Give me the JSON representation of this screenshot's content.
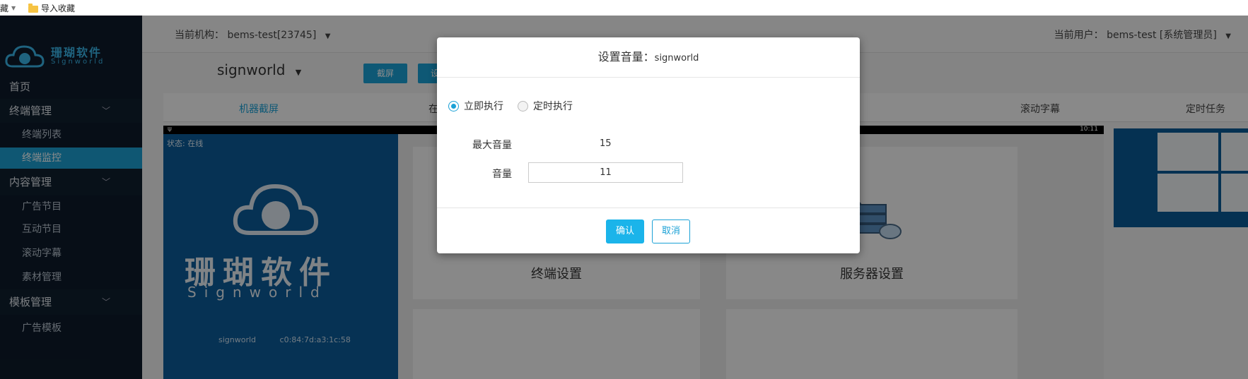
{
  "bookmarks": {
    "item0": "藏",
    "item1": "导入收藏"
  },
  "sidebar": {
    "logo_cn": "珊瑚软件",
    "logo_en": "Signworld",
    "home": "首页",
    "groups": [
      {
        "label": "终端管理",
        "items": [
          "终端列表",
          "终端监控"
        ]
      },
      {
        "label": "内容管理",
        "items": [
          "广告节目",
          "互动节目",
          "滚动字幕",
          "素材管理"
        ]
      },
      {
        "label": "模板管理",
        "items": [
          "广告模板"
        ]
      }
    ]
  },
  "header": {
    "org_label": "当前机构：",
    "org_value": "bems-test[23745]",
    "user_label": "当前用户：",
    "user_value": "bems-test [系统管理员]"
  },
  "main": {
    "device": "signworld",
    "btn_screenshot": "截屏",
    "btn_second": "设",
    "tabs": [
      "机器截屏",
      "在",
      "滚动字幕",
      "定时任务"
    ],
    "status_time": "10:11",
    "panel_status": "状态: 在线",
    "panel_cn": "珊瑚软件",
    "panel_en": "Signworld",
    "panel_device": "signworld",
    "panel_mac": "c0:84:7d:a3:1c:58",
    "card_terminal": "终端设置",
    "card_server": "服务器设置"
  },
  "modal": {
    "title": "设置音量：",
    "device": "signworld",
    "radio_now": "立即执行",
    "radio_timed": "定时执行",
    "max_volume_label": "最大音量",
    "max_volume_value": "15",
    "volume_label": "音量",
    "volume_value": "11",
    "confirm": "确认",
    "cancel": "取消"
  },
  "colors": {
    "accent": "#1ba1d6",
    "sidebar_bg": "#0d1b2a",
    "active_nav": "#1c9fd1"
  }
}
